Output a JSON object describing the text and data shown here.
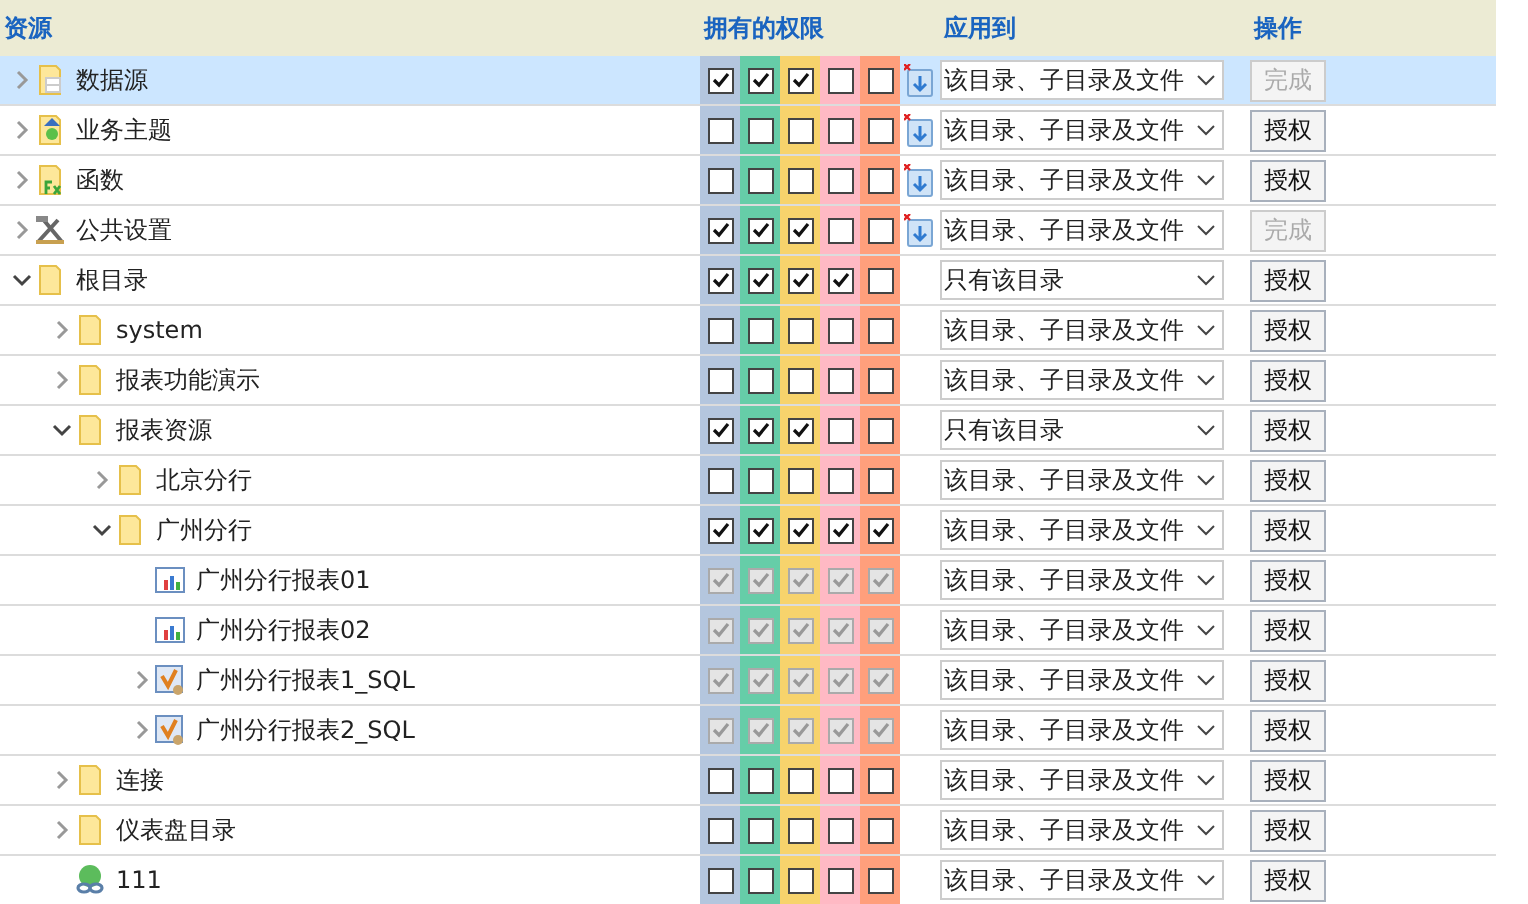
{
  "columns": [
    "资源",
    "拥有的权限",
    "应用到",
    "操作"
  ],
  "rows": [
    {
      "name": "数据源",
      "kind": "datasource",
      "expanded": false,
      "selected": true,
      "inherited": false,
      "import_icon": true,
      "perms": [
        true,
        true,
        true,
        false,
        false
      ],
      "apply": "该目录、子目录及文件",
      "action": {
        "label": "完成",
        "disabled": true
      }
    },
    {
      "name": "业务主题",
      "kind": "subject",
      "expanded": false,
      "selected": false,
      "inherited": false,
      "import_icon": true,
      "perms": [
        false,
        false,
        false,
        false,
        false
      ],
      "apply": "该目录、子目录及文件",
      "action": {
        "label": "授权",
        "disabled": false
      }
    },
    {
      "name": "函数",
      "kind": "function",
      "expanded": false,
      "selected": false,
      "inherited": false,
      "import_icon": true,
      "perms": [
        false,
        false,
        false,
        false,
        false
      ],
      "apply": "该目录、子目录及文件",
      "action": {
        "label": "授权",
        "disabled": false
      }
    },
    {
      "name": "公共设置",
      "kind": "settings",
      "expanded": false,
      "selected": false,
      "inherited": false,
      "import_icon": true,
      "perms": [
        true,
        true,
        true,
        false,
        false
      ],
      "apply": "该目录、子目录及文件",
      "action": {
        "label": "完成",
        "disabled": true
      }
    },
    {
      "name": "根目录",
      "kind": "folder",
      "expanded": true,
      "selected": false,
      "inherited": false,
      "import_icon": false,
      "perms": [
        true,
        true,
        true,
        true,
        false
      ],
      "apply": "只有该目录",
      "action": {
        "label": "授权",
        "disabled": false
      },
      "children": [
        {
          "name": "system",
          "kind": "folder",
          "expanded": false,
          "selected": false,
          "inherited": false,
          "import_icon": false,
          "perms": [
            false,
            false,
            false,
            false,
            false
          ],
          "apply": "该目录、子目录及文件",
          "action": {
            "label": "授权",
            "disabled": false
          }
        },
        {
          "name": "报表功能演示",
          "kind": "folder",
          "expanded": false,
          "selected": false,
          "inherited": false,
          "import_icon": false,
          "perms": [
            false,
            false,
            false,
            false,
            false
          ],
          "apply": "该目录、子目录及文件",
          "action": {
            "label": "授权",
            "disabled": false
          }
        },
        {
          "name": "报表资源",
          "kind": "folder",
          "expanded": true,
          "selected": false,
          "inherited": false,
          "import_icon": false,
          "perms": [
            true,
            true,
            true,
            false,
            false
          ],
          "apply": "只有该目录",
          "action": {
            "label": "授权",
            "disabled": false
          },
          "children": [
            {
              "name": "北京分行",
              "kind": "folder",
              "expanded": false,
              "selected": false,
              "inherited": false,
              "import_icon": false,
              "perms": [
                false,
                false,
                false,
                false,
                false
              ],
              "apply": "该目录、子目录及文件",
              "action": {
                "label": "授权",
                "disabled": false
              }
            },
            {
              "name": "广州分行",
              "kind": "folder",
              "expanded": true,
              "selected": false,
              "inherited": false,
              "import_icon": false,
              "perms": [
                true,
                true,
                true,
                true,
                true
              ],
              "apply": "该目录、子目录及文件",
              "action": {
                "label": "授权",
                "disabled": false
              },
              "children": [
                {
                  "name": "广州分行报表01",
                  "kind": "report",
                  "selected": false,
                  "inherited": true,
                  "import_icon": false,
                  "perms": [
                    true,
                    true,
                    true,
                    true,
                    true
                  ],
                  "apply": "该目录、子目录及文件",
                  "action": {
                    "label": "授权",
                    "disabled": false
                  }
                },
                {
                  "name": "广州分行报表02",
                  "kind": "report",
                  "selected": false,
                  "inherited": true,
                  "import_icon": false,
                  "perms": [
                    true,
                    true,
                    true,
                    true,
                    true
                  ],
                  "apply": "该目录、子目录及文件",
                  "action": {
                    "label": "授权",
                    "disabled": false
                  }
                },
                {
                  "name": "广州分行报表1_SQL",
                  "kind": "sql",
                  "expanded": false,
                  "selected": false,
                  "inherited": true,
                  "import_icon": false,
                  "perms": [
                    true,
                    true,
                    true,
                    true,
                    true
                  ],
                  "apply": "该目录、子目录及文件",
                  "action": {
                    "label": "授权",
                    "disabled": false
                  }
                },
                {
                  "name": "广州分行报表2_SQL",
                  "kind": "sql",
                  "expanded": false,
                  "selected": false,
                  "inherited": true,
                  "import_icon": false,
                  "perms": [
                    true,
                    true,
                    true,
                    true,
                    true
                  ],
                  "apply": "该目录、子目录及文件",
                  "action": {
                    "label": "授权",
                    "disabled": false
                  }
                }
              ]
            }
          ]
        },
        {
          "name": "连接",
          "kind": "folder",
          "expanded": false,
          "selected": false,
          "inherited": false,
          "import_icon": false,
          "perms": [
            false,
            false,
            false,
            false,
            false
          ],
          "apply": "该目录、子目录及文件",
          "action": {
            "label": "授权",
            "disabled": false
          }
        },
        {
          "name": "仪表盘目录",
          "kind": "folder",
          "expanded": false,
          "selected": false,
          "inherited": false,
          "import_icon": false,
          "perms": [
            false,
            false,
            false,
            false,
            false
          ],
          "apply": "该目录、子目录及文件",
          "action": {
            "label": "授权",
            "disabled": false
          }
        },
        {
          "name": "111",
          "kind": "link",
          "selected": false,
          "inherited": false,
          "import_icon": false,
          "perms": [
            false,
            false,
            false,
            false,
            false
          ],
          "apply": "该目录、子目录及文件",
          "action": {
            "label": "授权",
            "disabled": false
          }
        }
      ]
    }
  ]
}
